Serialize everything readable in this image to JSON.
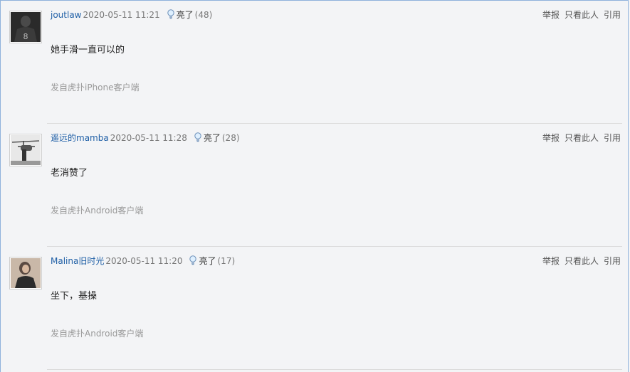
{
  "posts": [
    {
      "username": "joutlaw",
      "time": "2020-05-11 11:21",
      "light_label": "亮了",
      "light_count": "(48)",
      "content": "她手滑一直可以的",
      "source": "发自虎扑iPhone客户端"
    },
    {
      "username": "遥远的mamba",
      "time": "2020-05-11 11:28",
      "light_label": "亮了",
      "light_count": "(28)",
      "content": "老消赞了",
      "source": "发自虎扑Android客户端"
    },
    {
      "username": "Malina旧时光",
      "time": "2020-05-11 11:20",
      "light_label": "亮了",
      "light_count": "(17)",
      "content": "坐下，基操",
      "source": "发自虎扑Android客户端"
    }
  ],
  "ops": {
    "report": "举报",
    "only_this": "只看此人",
    "quote": "引用"
  },
  "colors": {
    "username": "#1f5fa6",
    "background": "#f3f4f6",
    "border": "#8fb2dc"
  }
}
